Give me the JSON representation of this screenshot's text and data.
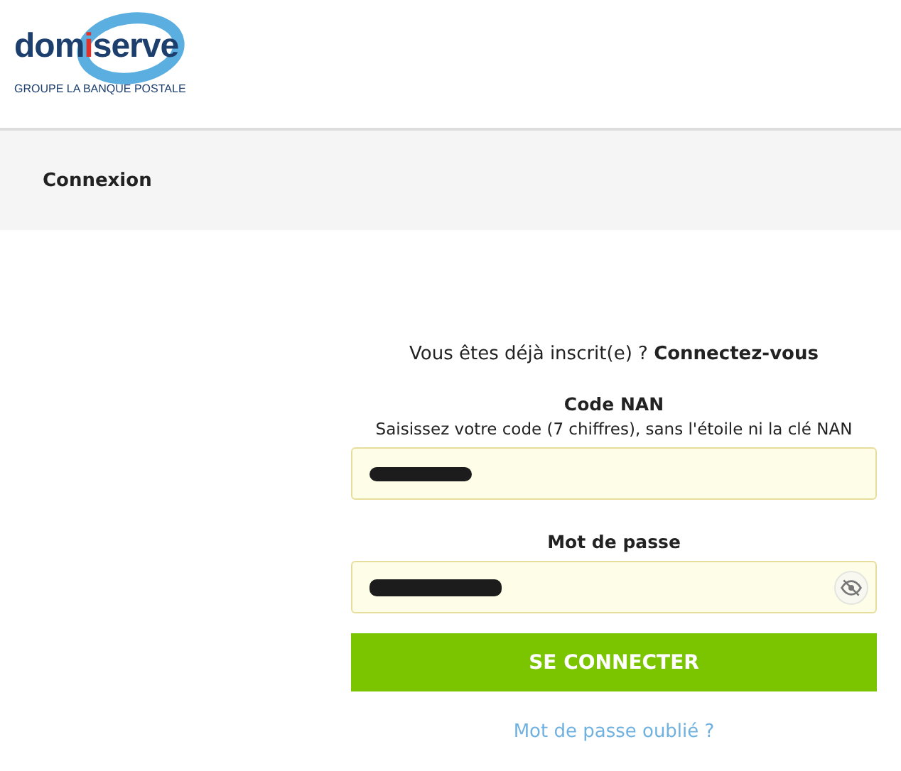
{
  "logo": {
    "wordmark": [
      {
        "text": "dom",
        "accent": false
      },
      {
        "text": "i",
        "accent": true
      },
      {
        "text": "serve",
        "accent": false
      }
    ],
    "tagline": "GROUPE LA BANQUE POSTALE"
  },
  "page_title": "Connexion",
  "intro": "Vous êtes déjà inscrit(e) ? **Connectez-vous**",
  "fields": [
    {
      "label": "Code NAN",
      "hint": "Saisissez votre code (7 chiffres), sans l'étoile ni la clé NAN",
      "kind": "text",
      "redacted": true
    },
    {
      "label": "Mot de passe",
      "kind": "password",
      "redacted": true,
      "show_toggle": true
    }
  ],
  "submit": "SE CONNECTER",
  "forgot_link": "Mot de passe oublié ?"
}
